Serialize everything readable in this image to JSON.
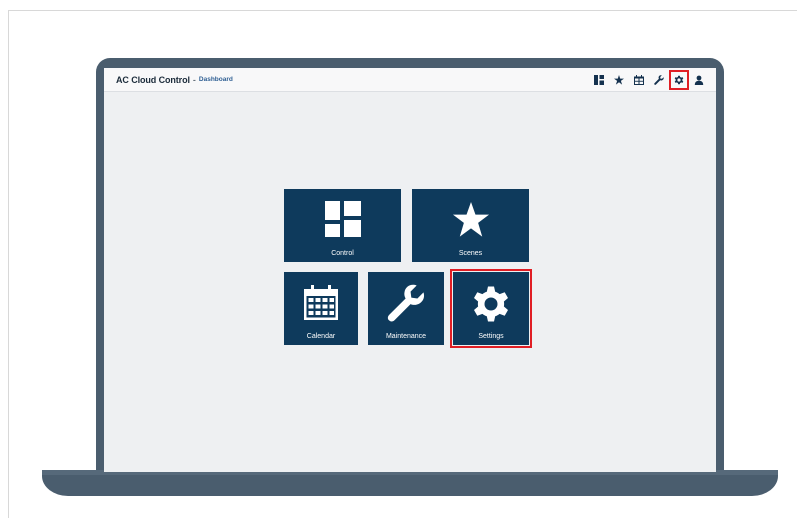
{
  "header": {
    "app_title": "AC Cloud Control",
    "separator": "-",
    "breadcrumb": "Dashboard",
    "icons": [
      "dashboard-icon",
      "star-icon",
      "calendar-icon",
      "wrench-icon",
      "gear-icon",
      "user-icon"
    ],
    "highlighted_icon": "gear-icon"
  },
  "tiles": [
    {
      "label": "Control",
      "icon": "dashboard-icon"
    },
    {
      "label": "Scenes",
      "icon": "star-icon"
    },
    {
      "label": "Calendar",
      "icon": "calendar-icon"
    },
    {
      "label": "Maintenance",
      "icon": "wrench-icon"
    },
    {
      "label": "Settings",
      "icon": "gear-icon"
    }
  ],
  "highlighted_tile": "Settings",
  "colors": {
    "tile_bg": "#0e3a5c",
    "highlight": "#e01e24",
    "laptop": "#4a5d6e",
    "screen_bg": "#eef0f2"
  }
}
